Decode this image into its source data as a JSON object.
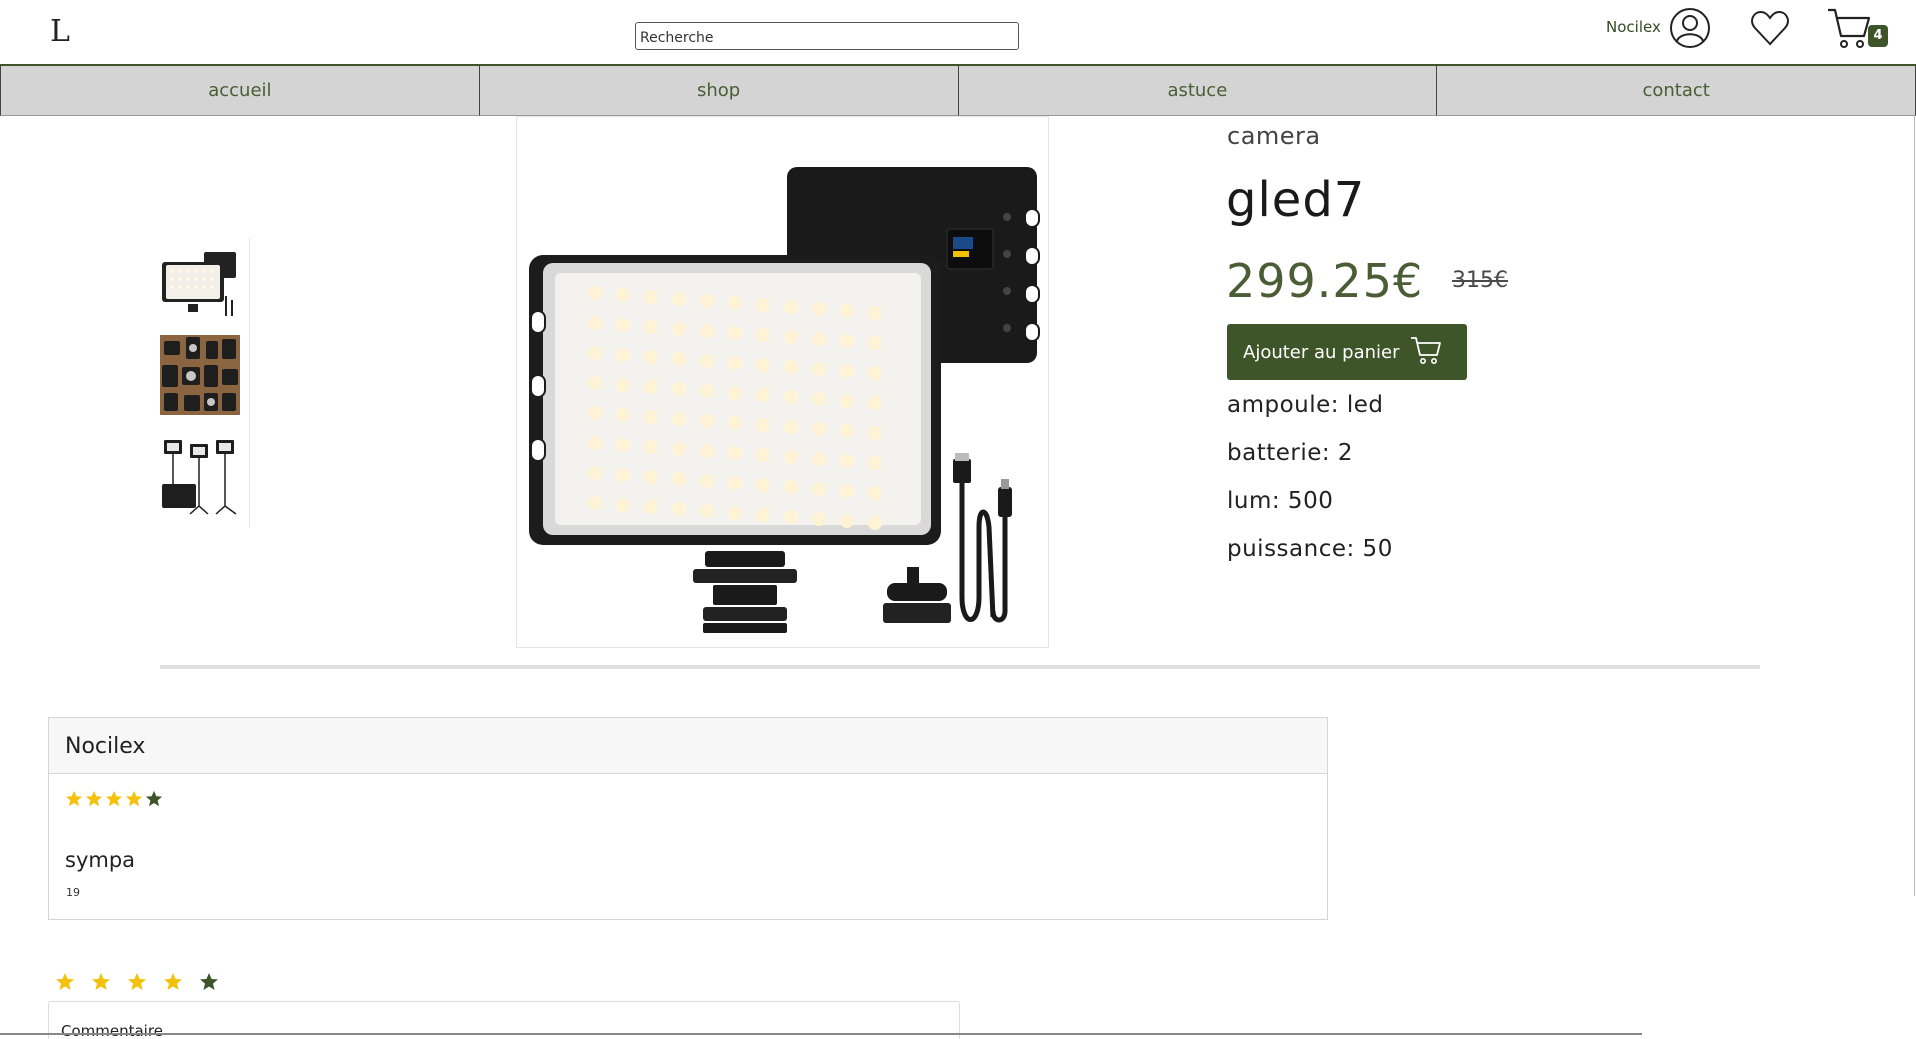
{
  "header": {
    "logo": "L",
    "search_placeholder": "Recherche",
    "user_name": "Nocilex",
    "cart_count": "4"
  },
  "nav": [
    {
      "label": "accueil"
    },
    {
      "label": "shop"
    },
    {
      "label": "astuce"
    },
    {
      "label": "contact"
    }
  ],
  "product": {
    "category": "camera",
    "name": "gled7",
    "price": "299.25€",
    "old_price": "315€",
    "add_to_cart_label": "Ajouter au panier",
    "specs": [
      {
        "text": "ampoule: led"
      },
      {
        "text": "batterie: 2"
      },
      {
        "text": "lum: 500"
      },
      {
        "text": "puissance: 50"
      }
    ]
  },
  "review": {
    "author": "Nocilex",
    "rating": 4,
    "max_rating": 5,
    "comment": "sympa",
    "date": "19"
  },
  "new_review": {
    "rating": 4,
    "comment_label": "Commentaire"
  },
  "colors": {
    "accent": "#3e5429",
    "star": "#f4c20d",
    "star_empty": "#3e5429",
    "nav_bg": "#d4d4d4"
  }
}
